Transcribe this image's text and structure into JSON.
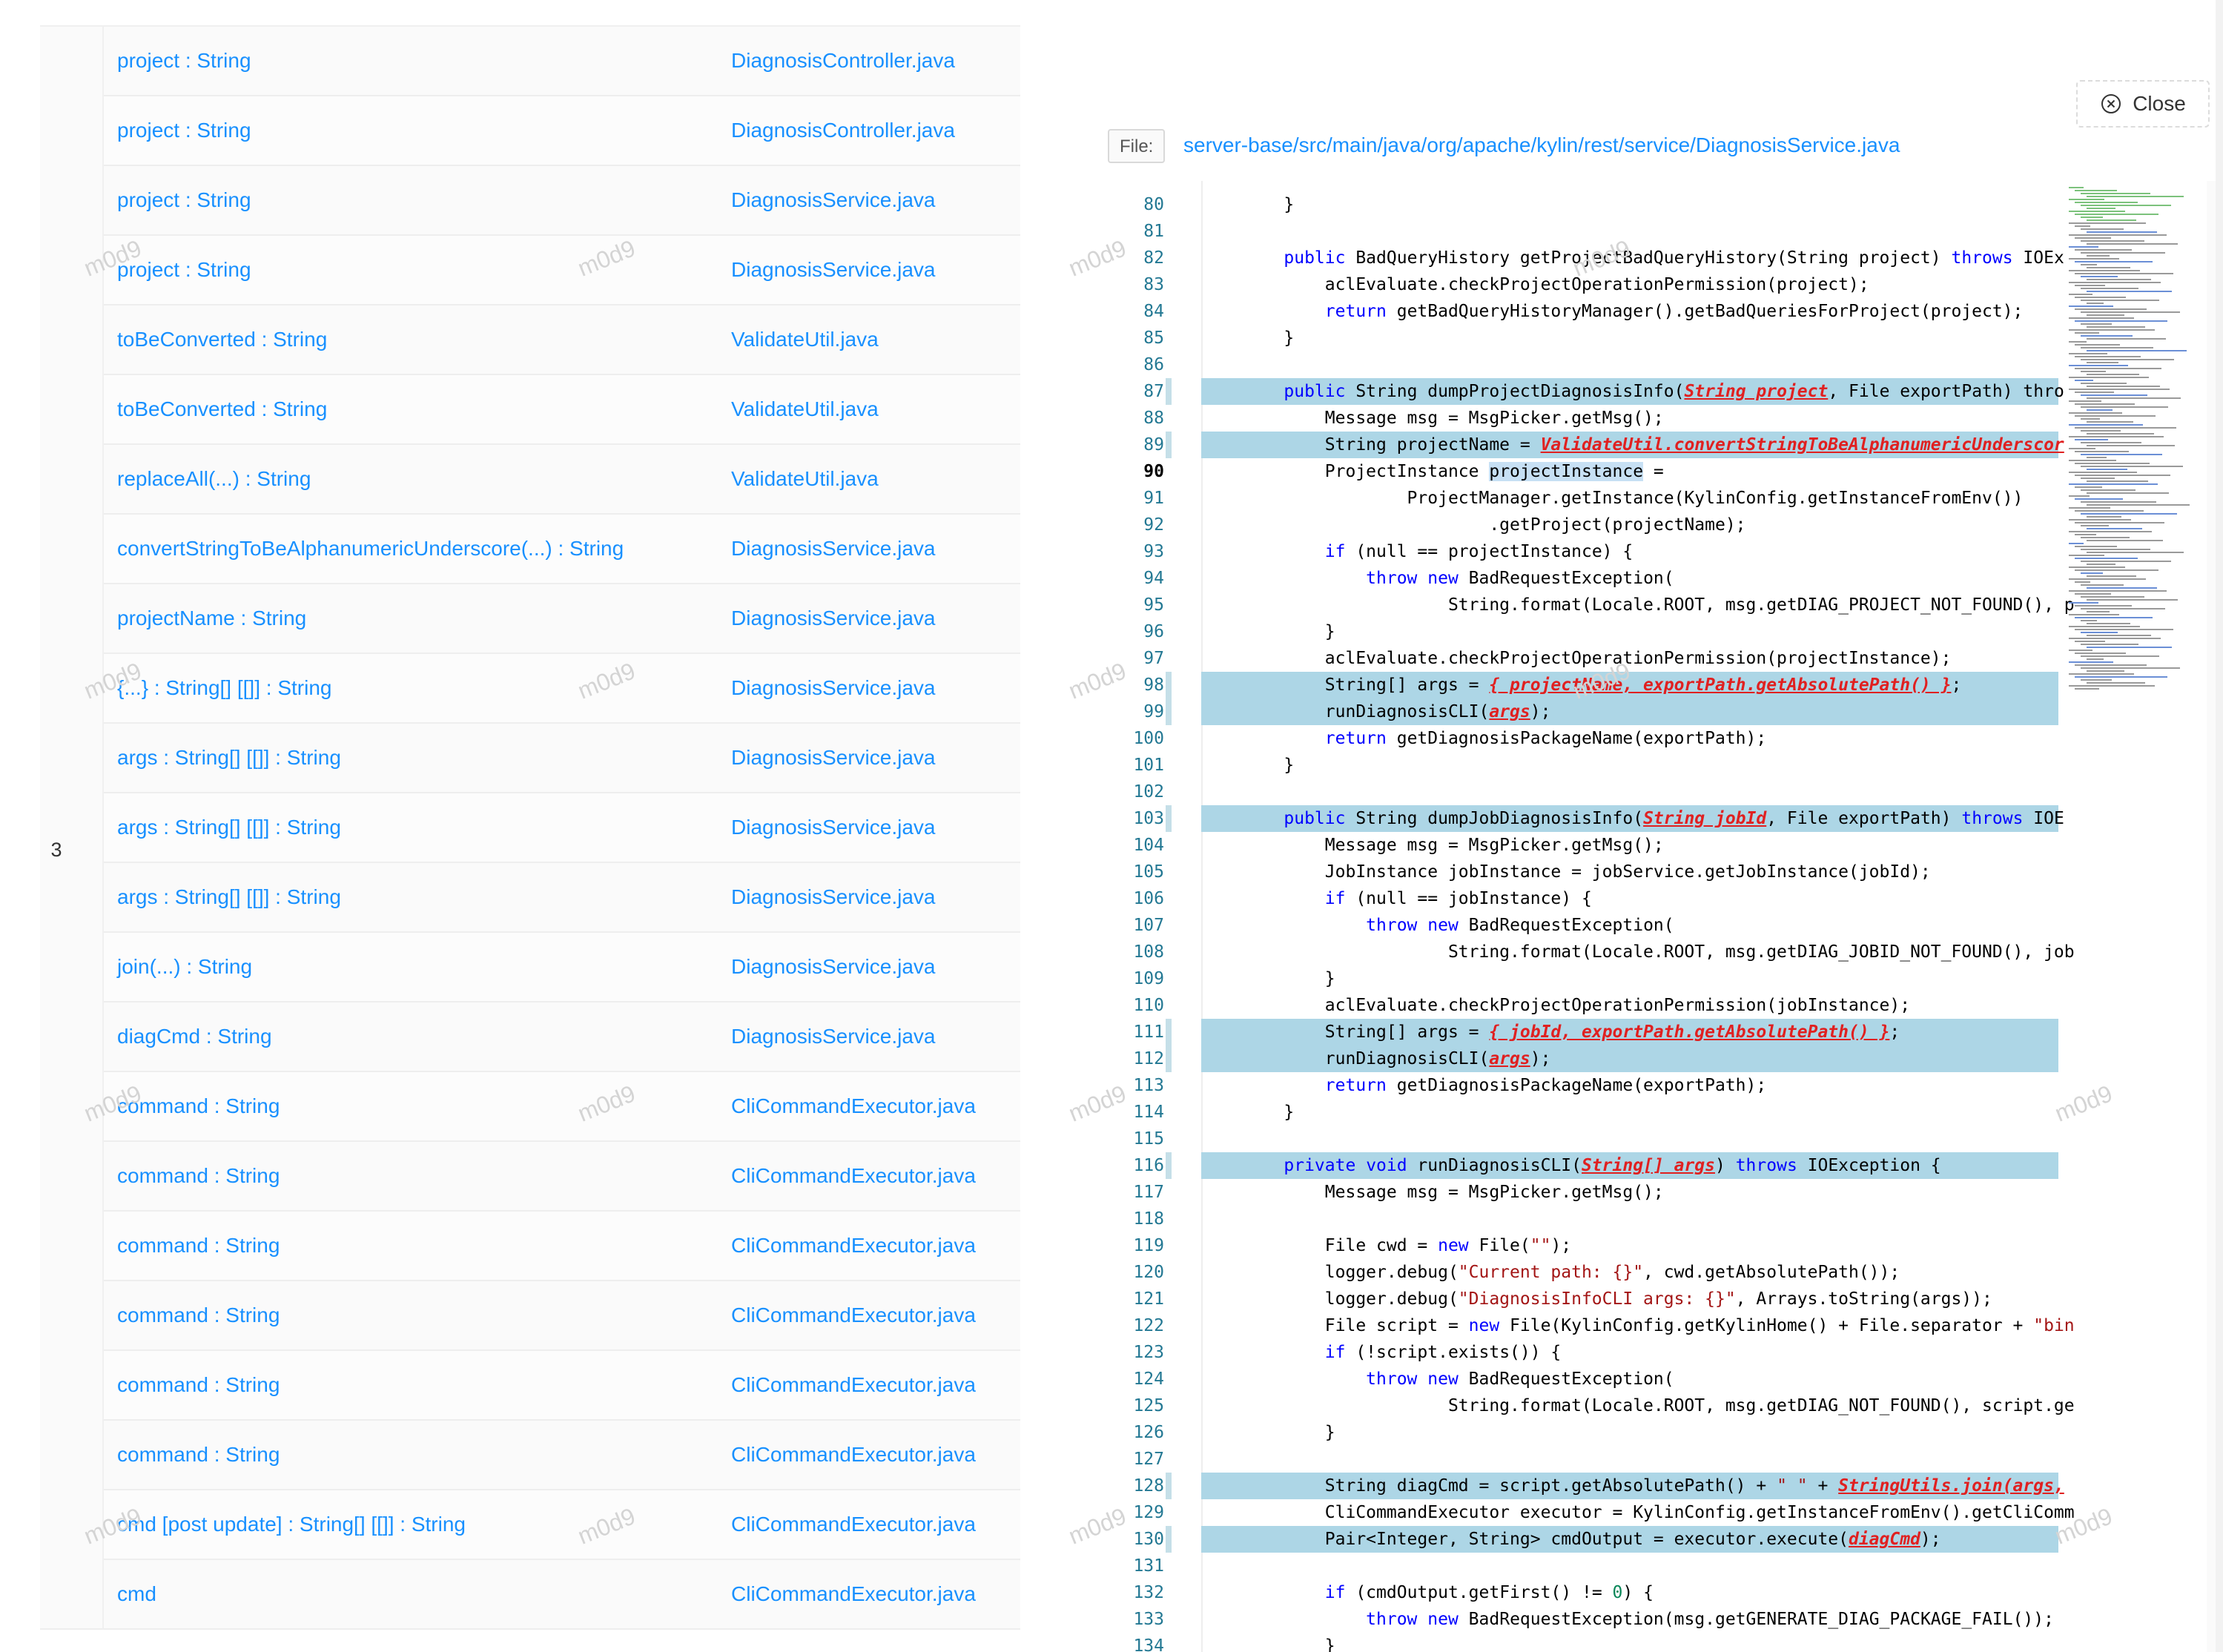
{
  "left": {
    "group_number": "3",
    "rows": [
      {
        "var": "project : String",
        "file": "DiagnosisController.java"
      },
      {
        "var": "project : String",
        "file": "DiagnosisController.java"
      },
      {
        "var": "project : String",
        "file": "DiagnosisService.java"
      },
      {
        "var": "project : String",
        "file": "DiagnosisService.java"
      },
      {
        "var": "toBeConverted : String",
        "file": "ValidateUtil.java"
      },
      {
        "var": "toBeConverted : String",
        "file": "ValidateUtil.java"
      },
      {
        "var": "replaceAll(...) : String",
        "file": "ValidateUtil.java"
      },
      {
        "var": "convertStringToBeAlphanumericUnderscore(...) : String",
        "file": "DiagnosisService.java"
      },
      {
        "var": "projectName : String",
        "file": "DiagnosisService.java"
      },
      {
        "var": "{...} : String[] [[]] : String",
        "file": "DiagnosisService.java"
      },
      {
        "var": "args : String[] [[]] : String",
        "file": "DiagnosisService.java"
      },
      {
        "var": "args : String[] [[]] : String",
        "file": "DiagnosisService.java"
      },
      {
        "var": "args : String[] [[]] : String",
        "file": "DiagnosisService.java"
      },
      {
        "var": "join(...) : String",
        "file": "DiagnosisService.java"
      },
      {
        "var": "diagCmd : String",
        "file": "DiagnosisService.java"
      },
      {
        "var": "command : String",
        "file": "CliCommandExecutor.java"
      },
      {
        "var": "command : String",
        "file": "CliCommandExecutor.java"
      },
      {
        "var": "command : String",
        "file": "CliCommandExecutor.java"
      },
      {
        "var": "command : String",
        "file": "CliCommandExecutor.java"
      },
      {
        "var": "command : String",
        "file": "CliCommandExecutor.java"
      },
      {
        "var": "command : String",
        "file": "CliCommandExecutor.java"
      },
      {
        "var": "cmd [post update] : String[] [[]] : String",
        "file": "CliCommandExecutor.java"
      },
      {
        "var": "cmd",
        "file": "CliCommandExecutor.java"
      }
    ]
  },
  "watermark_text": "m0d9",
  "close_button": {
    "label": "Close",
    "icon": "close-circle-icon"
  },
  "file": {
    "badge": "File:",
    "path": "server-base/src/main/java/org/apache/kylin/rest/service/DiagnosisService.java"
  },
  "editor": {
    "current_line": 90,
    "lines": [
      {
        "n": 80,
        "code": "    }"
      },
      {
        "n": 81,
        "code": ""
      },
      {
        "n": 82,
        "code": "    public BadQueryHistory getProjectBadQueryHistory(String project) throws IOEx"
      },
      {
        "n": 83,
        "code": "        aclEvaluate.checkProjectOperationPermission(project);"
      },
      {
        "n": 84,
        "code": "        return getBadQueryHistoryManager().getBadQueriesForProject(project);"
      },
      {
        "n": 85,
        "code": "    }"
      },
      {
        "n": 86,
        "code": ""
      },
      {
        "n": 87,
        "code": "    public String dumpProjectDiagnosisInfo(String project, File exportPath) thro",
        "hl": true
      },
      {
        "n": 88,
        "code": "        Message msg = MsgPicker.getMsg();"
      },
      {
        "n": 89,
        "code": "        String projectName = ValidateUtil.convertStringToBeAlphanumericUnderscor",
        "hl": true
      },
      {
        "n": 90,
        "code": "        ProjectInstance projectInstance ="
      },
      {
        "n": 91,
        "code": "                ProjectManager.getInstance(KylinConfig.getInstanceFromEnv())"
      },
      {
        "n": 92,
        "code": "                        .getProject(projectName);"
      },
      {
        "n": 93,
        "code": "        if (null == projectInstance) {"
      },
      {
        "n": 94,
        "code": "            throw new BadRequestException("
      },
      {
        "n": 95,
        "code": "                    String.format(Locale.ROOT, msg.getDIAG_PROJECT_NOT_FOUND(), p"
      },
      {
        "n": 96,
        "code": "        }"
      },
      {
        "n": 97,
        "code": "        aclEvaluate.checkProjectOperationPermission(projectInstance);"
      },
      {
        "n": 98,
        "code": "        String[] args = { projectName, exportPath.getAbsolutePath() };",
        "hl": true
      },
      {
        "n": 99,
        "code": "        runDiagnosisCLI(args);",
        "hl": true
      },
      {
        "n": 100,
        "code": "        return getDiagnosisPackageName(exportPath);"
      },
      {
        "n": 101,
        "code": "    }"
      },
      {
        "n": 102,
        "code": ""
      },
      {
        "n": 103,
        "code": "    public String dumpJobDiagnosisInfo(String jobId, File exportPath) throws IOE",
        "hl": true
      },
      {
        "n": 104,
        "code": "        Message msg = MsgPicker.getMsg();"
      },
      {
        "n": 105,
        "code": "        JobInstance jobInstance = jobService.getJobInstance(jobId);"
      },
      {
        "n": 106,
        "code": "        if (null == jobInstance) {"
      },
      {
        "n": 107,
        "code": "            throw new BadRequestException("
      },
      {
        "n": 108,
        "code": "                    String.format(Locale.ROOT, msg.getDIAG_JOBID_NOT_FOUND(), job"
      },
      {
        "n": 109,
        "code": "        }"
      },
      {
        "n": 110,
        "code": "        aclEvaluate.checkProjectOperationPermission(jobInstance);"
      },
      {
        "n": 111,
        "code": "        String[] args = { jobId, exportPath.getAbsolutePath() };",
        "hl": true
      },
      {
        "n": 112,
        "code": "        runDiagnosisCLI(args);",
        "hl": true
      },
      {
        "n": 113,
        "code": "        return getDiagnosisPackageName(exportPath);"
      },
      {
        "n": 114,
        "code": "    }"
      },
      {
        "n": 115,
        "code": ""
      },
      {
        "n": 116,
        "code": "    private void runDiagnosisCLI(String[] args) throws IOException {",
        "hl": true
      },
      {
        "n": 117,
        "code": "        Message msg = MsgPicker.getMsg();"
      },
      {
        "n": 118,
        "code": ""
      },
      {
        "n": 119,
        "code": "        File cwd = new File(\"\");"
      },
      {
        "n": 120,
        "code": "        logger.debug(\"Current path: {}\", cwd.getAbsolutePath());"
      },
      {
        "n": 121,
        "code": "        logger.debug(\"DiagnosisInfoCLI args: {}\", Arrays.toString(args));"
      },
      {
        "n": 122,
        "code": "        File script = new File(KylinConfig.getKylinHome() + File.separator + \"bin"
      },
      {
        "n": 123,
        "code": "        if (!script.exists()) {"
      },
      {
        "n": 124,
        "code": "            throw new BadRequestException("
      },
      {
        "n": 125,
        "code": "                    String.format(Locale.ROOT, msg.getDIAG_NOT_FOUND(), script.ge"
      },
      {
        "n": 126,
        "code": "        }"
      },
      {
        "n": 127,
        "code": ""
      },
      {
        "n": 128,
        "code": "        String diagCmd = script.getAbsolutePath() + \" \" + StringUtils.join(args,",
        "hl": true
      },
      {
        "n": 129,
        "code": "        CliCommandExecutor executor = KylinConfig.getInstanceFromEnv().getCliComm"
      },
      {
        "n": 130,
        "code": "        Pair<Integer, String> cmdOutput = executor.execute(diagCmd);",
        "hl": true
      },
      {
        "n": 131,
        "code": ""
      },
      {
        "n": 132,
        "code": "        if (cmdOutput.getFirst() != 0) {"
      },
      {
        "n": 133,
        "code": "            throw new BadRequestException(msg.getGENERATE_DIAG_PACKAGE_FAIL());"
      },
      {
        "n": 134,
        "code": "        }"
      }
    ],
    "tainted_tokens": [
      "String project",
      "ValidateUtil.convertStringToBeAlphanumericUnderscor",
      "{ projectName, exportPath.getAbsolutePath() }",
      "args",
      "String jobId",
      "{ jobId, exportPath.getAbsolutePath() }",
      "String[] args",
      "StringUtils.join(args,",
      "diagCmd"
    ]
  }
}
